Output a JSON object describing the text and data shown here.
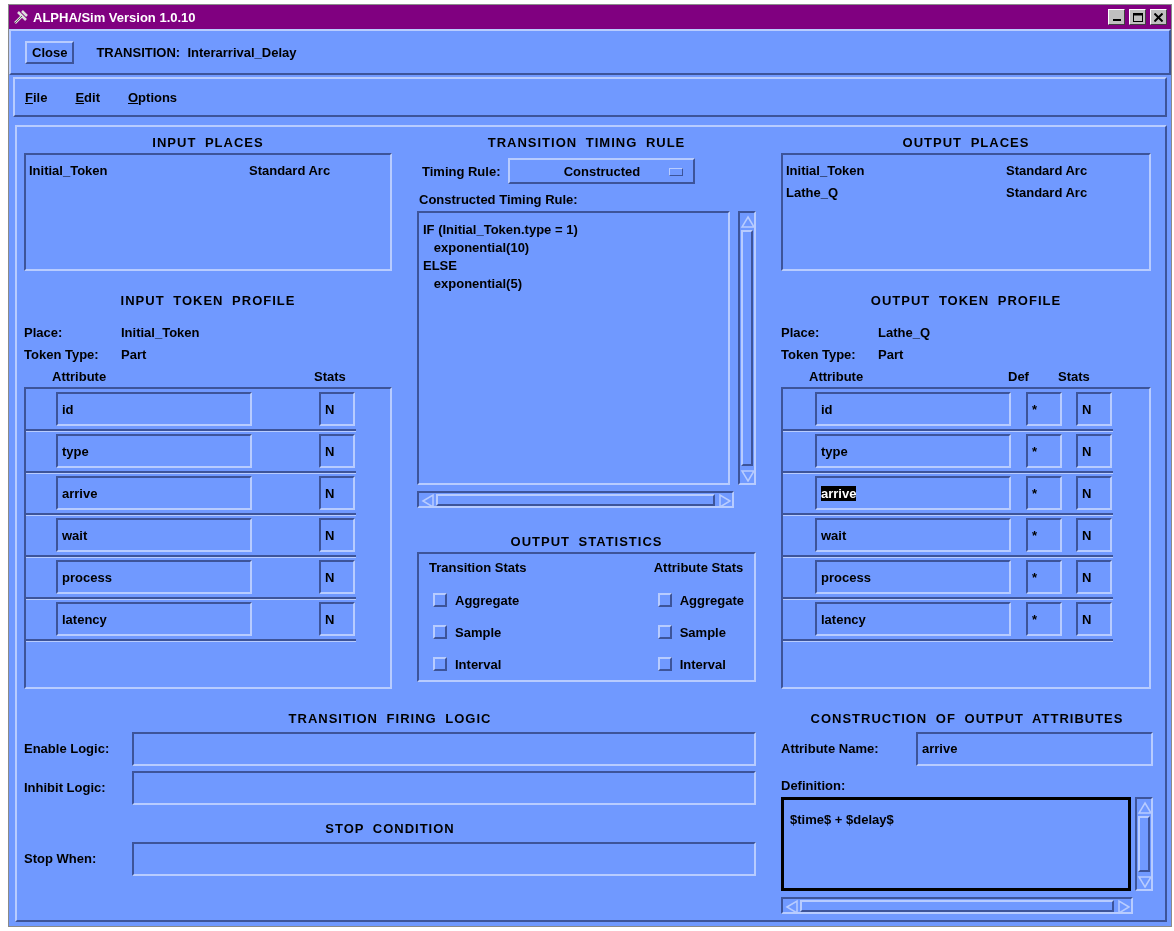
{
  "window": {
    "title": "ALPHA/Sim Version 1.0.10"
  },
  "toolbar": {
    "close_button": "Close",
    "heading": "TRANSITION:  Interarrival_Delay"
  },
  "menu": [
    "File",
    "Edit",
    "Options"
  ],
  "input_places": {
    "title": "INPUT PLACES",
    "rows": [
      {
        "place": "Initial_Token",
        "arc": "Standard Arc"
      }
    ]
  },
  "input_token_profile": {
    "title": "INPUT TOKEN PROFILE",
    "place_label": "Place:",
    "place": "Initial_Token",
    "type_label": "Token Type:",
    "type": "Part",
    "columns": [
      "Attribute",
      "Stats"
    ],
    "rows": [
      {
        "attribute": "id",
        "stats": "N"
      },
      {
        "attribute": "type",
        "stats": "N"
      },
      {
        "attribute": "arrive",
        "stats": "N"
      },
      {
        "attribute": "wait",
        "stats": "N"
      },
      {
        "attribute": "process",
        "stats": "N"
      },
      {
        "attribute": "latency",
        "stats": "N"
      }
    ]
  },
  "timing_rule": {
    "title": "TRANSITION TIMING RULE",
    "rule_label": "Timing Rule:",
    "rule": "Constructed",
    "constructed_label": "Constructed Timing Rule:",
    "text": "IF (Initial_Token.type = 1)\n   exponential(10)\nELSE\n   exponential(5)"
  },
  "output_statistics": {
    "title": "OUTPUT STATISTICS",
    "groups": [
      {
        "label": "Transition Stats",
        "options": [
          {
            "label": "Aggregate",
            "checked": false
          },
          {
            "label": "Sample",
            "checked": false
          },
          {
            "label": "Interval",
            "checked": false
          }
        ]
      },
      {
        "label": "Attribute Stats",
        "options": [
          {
            "label": "Aggregate",
            "checked": false
          },
          {
            "label": "Sample",
            "checked": false
          },
          {
            "label": "Interval",
            "checked": false
          }
        ]
      }
    ]
  },
  "output_places": {
    "title": "OUTPUT PLACES",
    "rows": [
      {
        "place": "Initial_Token",
        "arc": "Standard Arc"
      },
      {
        "place": "Lathe_Q",
        "arc": "Standard Arc"
      }
    ]
  },
  "output_token_profile": {
    "title": "OUTPUT TOKEN PROFILE",
    "place_label": "Place:",
    "place": "Lathe_Q",
    "type_label": "Token Type:",
    "type": "Part",
    "columns": [
      "Attribute",
      "Def",
      "Stats"
    ],
    "rows": [
      {
        "attribute": "id",
        "def": "*",
        "stats": "N",
        "selected": false
      },
      {
        "attribute": "type",
        "def": "*",
        "stats": "N",
        "selected": false
      },
      {
        "attribute": "arrive",
        "def": "*",
        "stats": "N",
        "selected": true
      },
      {
        "attribute": "wait",
        "def": "*",
        "stats": "N",
        "selected": false
      },
      {
        "attribute": "process",
        "def": "*",
        "stats": "N",
        "selected": false
      },
      {
        "attribute": "latency",
        "def": "*",
        "stats": "N",
        "selected": false
      }
    ]
  },
  "firing_logic": {
    "title": "TRANSITION FIRING LOGIC",
    "fields": [
      {
        "label": "Enable Logic:"
      },
      {
        "label": "Inhibit Logic:"
      }
    ]
  },
  "stop_condition": {
    "title": "STOP CONDITION",
    "fields": [
      {
        "label": "Stop When:"
      }
    ]
  },
  "construction": {
    "title": "CONSTRUCTION OF OUTPUT ATTRIBUTES",
    "name_label": "Attribute Name:",
    "name": "arrive",
    "definition_label": "Definition:",
    "definition": "$time$ + $delay$"
  }
}
